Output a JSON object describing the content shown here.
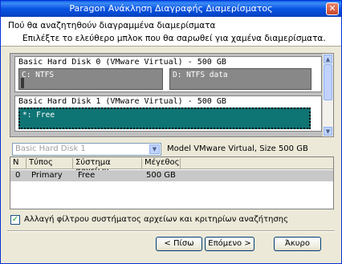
{
  "window": {
    "title": "Paragon Ανάκληση Διαγραφής Διαμερίσματος",
    "close_glyph": "✕"
  },
  "header": {
    "title": "Πού θα αναζητηθούν διαγραμμένα διαμερίσματα",
    "subtitle": "Επιλέξτε το ελεύθερο μπλοκ που θα σαρωθεί για χαμένα διαμερίσματα."
  },
  "disks": [
    {
      "label": "Basic Hard Disk 0 (VMware Virtual) - 500 GB",
      "partitions": [
        {
          "label": "C: NTFS"
        },
        {
          "label": "D: NTFS data"
        }
      ]
    },
    {
      "label": "Basic Hard Disk 1 (VMware Virtual) - 500 GB",
      "partitions": [
        {
          "label": "*: Free"
        }
      ]
    }
  ],
  "disk_select": {
    "value": "Basic Hard Disk 1",
    "model_text": "Model VMware Virtual, Size 500 GB"
  },
  "table": {
    "columns": [
      "N",
      "Τύπος",
      "Σύστημα αρχείων",
      "Μέγεθος"
    ],
    "rows": [
      {
        "n": "0",
        "type": "Primary",
        "fs": "Free",
        "size": "500 GB"
      }
    ]
  },
  "filter_checkbox": {
    "label": "Αλλαγή φίλτρου συστήματος αρχείων και κριτηρίων αναζήτησης",
    "checked": true
  },
  "buttons": {
    "back": "< Πίσω",
    "next": "Επόμενο >",
    "cancel": "Άκυρο"
  },
  "icons": {
    "close": "close-icon",
    "scroll_up": "scroll-up-icon",
    "scroll_down": "scroll-down-icon",
    "dropdown": "chevron-down-icon",
    "check": "checkmark-icon"
  }
}
